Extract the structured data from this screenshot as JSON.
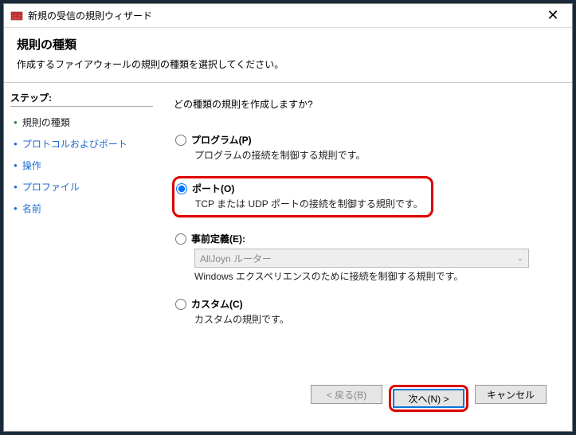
{
  "window": {
    "title": "新規の受信の規則ウィザード"
  },
  "header": {
    "title": "規則の種類",
    "subtitle": "作成するファイアウォールの規則の種類を選択してください。"
  },
  "sidebar": {
    "heading": "ステップ:",
    "items": [
      {
        "label": "規則の種類",
        "current": true
      },
      {
        "label": "プロトコルおよびポート",
        "current": false
      },
      {
        "label": "操作",
        "current": false
      },
      {
        "label": "プロファイル",
        "current": false
      },
      {
        "label": "名前",
        "current": false
      }
    ]
  },
  "main": {
    "question": "どの種類の規則を作成しますか?",
    "options": {
      "program": {
        "title": "プログラム(P)",
        "desc": "プログラムの接続を制御する規則です。"
      },
      "port": {
        "title": "ポート(O)",
        "desc": "TCP または UDP ポートの接続を制御する規則です。"
      },
      "predef": {
        "title": "事前定義(E):",
        "select": "AllJoyn ルーター",
        "desc": "Windows エクスペリエンスのために接続を制御する規則です。"
      },
      "custom": {
        "title": "カスタム(C)",
        "desc": "カスタムの規則です。"
      }
    }
  },
  "footer": {
    "back": "< 戻る(B)",
    "next": "次へ(N) >",
    "cancel": "キャンセル"
  }
}
